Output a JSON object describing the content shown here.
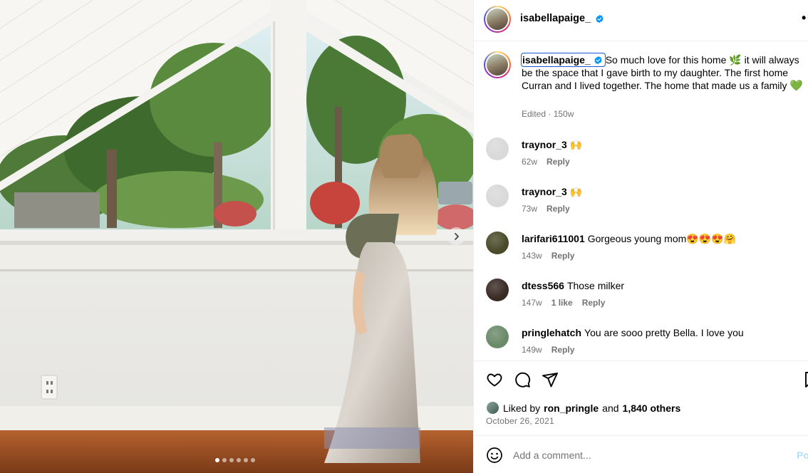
{
  "post": {
    "author": "isabellapaige_",
    "more_label": "•••",
    "caption": {
      "username": "isabellapaige_",
      "text_before_leaf": "So much love for this home ",
      "leaf_emoji": "🌿",
      "text_after_leaf": " it will always be the space that I gave birth to my daughter. The first home Curran and I lived together. The home that made us a family ",
      "heart_emoji": "💚",
      "meta": "Edited · 150w"
    },
    "carousel": {
      "slide_count": 6,
      "active_index": 0
    }
  },
  "comments": [
    {
      "username": "traynor_3",
      "text": "🙌",
      "age": "62w",
      "likes": "",
      "reply_label": "Reply",
      "avatar_color": "#d9d9d9"
    },
    {
      "username": "traynor_3",
      "text": "🙌",
      "age": "73w",
      "likes": "",
      "reply_label": "Reply",
      "avatar_color": "#d9d9d9"
    },
    {
      "username": "larifari611001",
      "text": "Gorgeous young mom😍😍😍🤗",
      "age": "143w",
      "likes": "",
      "reply_label": "Reply",
      "avatar_color": "#4a4a2a"
    },
    {
      "username": "dtess566",
      "text": "Those milker",
      "age": "147w",
      "likes": "1 like",
      "reply_label": "Reply",
      "avatar_color": "#3a2a24"
    },
    {
      "username": "pringlehatch",
      "text": "You are sooo pretty Bella. I love you",
      "age": "149w",
      "likes": "",
      "reply_label": "Reply",
      "avatar_color": "#6a8a6a"
    }
  ],
  "likes": {
    "prefix": "Liked by",
    "user": "ron_pringle",
    "and": "and",
    "others": "1,840 others"
  },
  "date": "October 26, 2021",
  "add_comment": {
    "placeholder": "Add a comment...",
    "post_label": "Post"
  },
  "colors": {
    "verified": "#0095f6",
    "meta_gray": "#737373",
    "focus_outline": "#1a58d6"
  },
  "icons": [
    "heart-icon",
    "comment-icon",
    "share-icon",
    "bookmark-icon",
    "emoji-icon",
    "chevron-right-icon",
    "verified-badge-icon"
  ]
}
